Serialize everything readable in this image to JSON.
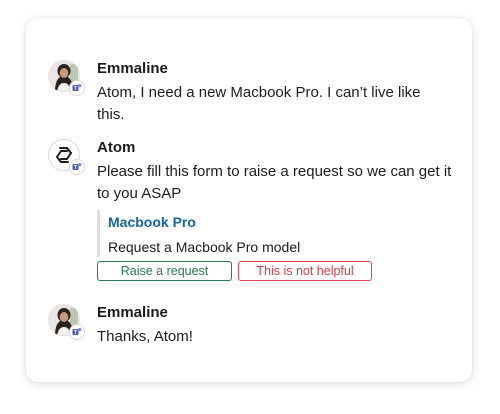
{
  "messages": [
    {
      "sender": "Emmaline",
      "text": "Atom, I need a new Macbook Pro. I can’t live like this."
    },
    {
      "sender": "Atom",
      "text": "Please fill this form to raise a request so we can get it to you ASAP",
      "attachment": {
        "title": "Macbook Pro",
        "body": "Request a Macbook Pro model"
      },
      "actions": {
        "primary_label": "Raise a request",
        "secondary_label": "This is not helpful"
      }
    },
    {
      "sender": "Emmaline",
      "text": "Thanks, Atom!"
    }
  ],
  "icons": {
    "user_avatar": "user-avatar-photo",
    "bot_avatar": "atom-logo-icon",
    "badge": "microsoft-teams-icon"
  },
  "colors": {
    "link": "#1264a3",
    "primary_button": "#2a7a4f",
    "danger_button": "#e0464f",
    "teams_purple": "#5059c9"
  }
}
